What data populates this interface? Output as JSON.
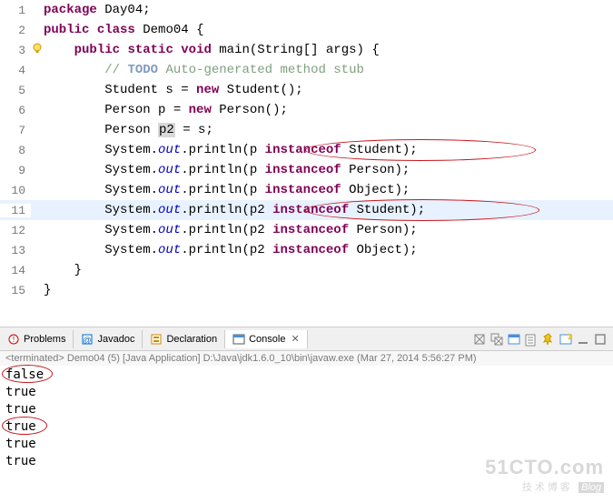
{
  "code": {
    "l1": {
      "n": "1",
      "pkg": "package",
      "pkgname": "Day04"
    },
    "l2": {
      "n": "2",
      "pub": "public",
      "cls": "class",
      "name": "Demo04"
    },
    "l3": {
      "n": "3",
      "pub": "public",
      "stat": "static",
      "void": "void",
      "main": "main",
      "args": "(String[] args) {"
    },
    "l4": {
      "n": "4",
      "todo": "TODO",
      "cmt": " Auto-generated method stub",
      "pre": "// "
    },
    "l5": {
      "n": "5",
      "t1": "Student s = ",
      "nw": "new",
      "t2": " Student();"
    },
    "l6": {
      "n": "6",
      "t1": "Person p = ",
      "nw": "new",
      "t2": " Person();"
    },
    "l7": {
      "n": "7",
      "t1": "Person ",
      "p2": "p2",
      "t2": " = s;"
    },
    "l8": {
      "n": "8",
      "t1": "System.",
      "out": "out",
      "t2": ".println(p ",
      "io": "instanceof",
      "t3": " Student);"
    },
    "l9": {
      "n": "9",
      "t1": "System.",
      "out": "out",
      "t2": ".println(p ",
      "io": "instanceof",
      "t3": " Person);"
    },
    "l10": {
      "n": "10",
      "t1": "System.",
      "out": "out",
      "t2": ".println(p ",
      "io": "instanceof",
      "t3": " Object);"
    },
    "l11": {
      "n": "11",
      "t1": "System.",
      "out": "out",
      "t2": ".println(p2 ",
      "io": "instanceof",
      "t3": " Student);"
    },
    "l12": {
      "n": "12",
      "t1": "System.",
      "out": "out",
      "t2": ".println(p2 ",
      "io": "instanceof",
      "t3": " Person);"
    },
    "l13": {
      "n": "13",
      "t1": "System.",
      "out": "out",
      "t2": ".println(p2 ",
      "io": "instanceof",
      "t3": " Object);"
    },
    "l14": {
      "n": "14",
      "t": "}"
    },
    "l15": {
      "n": "15",
      "t": "}"
    }
  },
  "tabs": {
    "problems": "Problems",
    "javadoc": "Javadoc",
    "declaration": "Declaration",
    "console": "Console"
  },
  "terminated": "<terminated> Demo04 (5) [Java Application] D:\\Java\\jdk1.6.0_10\\bin\\javaw.exe (Mar 27, 2014 5:56:27 PM)",
  "output": [
    "false",
    "true",
    "true",
    "true",
    "true",
    "true"
  ],
  "watermark": {
    "site": "51CTO.com",
    "sub": "技术博客",
    "blog": "Blog"
  }
}
